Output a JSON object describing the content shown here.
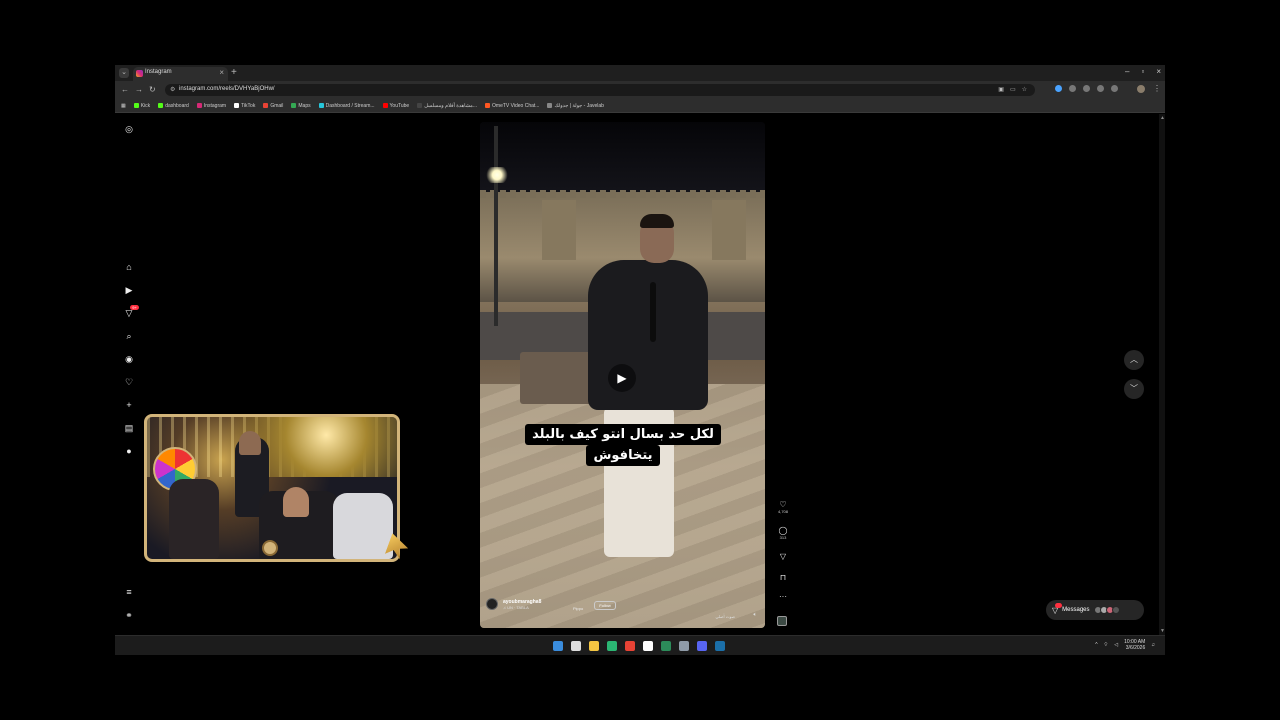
{
  "browser": {
    "tab_title": "Instagram",
    "tab_close": "×",
    "new_tab": "+",
    "url": "instagram.com/reels/DVHYaBjOHw/",
    "window_controls": [
      "–",
      "▫",
      "×"
    ],
    "bookmarks": [
      {
        "label": "Kick",
        "color": "#53fc18"
      },
      {
        "label": "dashboard",
        "color": "#53fc18"
      },
      {
        "label": "Instagram",
        "color": "#d62976"
      },
      {
        "label": "TikTok",
        "color": "#ffffff"
      },
      {
        "label": "Gmail",
        "color": "#ea4335"
      },
      {
        "label": "Maps",
        "color": "#34a853"
      },
      {
        "label": "Dashboard / Stream...",
        "color": "#26c6da"
      },
      {
        "label": "YouTube",
        "color": "#ff0000"
      },
      {
        "label": "مشاهدة أفلام ومسلسل...",
        "color": "#444444"
      },
      {
        "label": "OmeTV Video Chat...",
        "color": "#ff5722"
      },
      {
        "label": "جولة | جدولك - Javelab",
        "color": "#888888"
      }
    ]
  },
  "instagram": {
    "sidebar_icons": [
      "instagram-logo",
      "home",
      "reels",
      "messages",
      "search",
      "explore",
      "notifications",
      "create",
      "dashboard",
      "profile",
      "more",
      "also-from-meta"
    ],
    "notification_badge": "9+",
    "reel": {
      "caption_lines": [
        "لكل حد بسال انتو كيف بالبلد",
        "يتخافوش"
      ],
      "author": "ayoubmaragha8",
      "audio": "♫ UN · TABLA",
      "extra": "Pippo",
      "follow_label": "Follow",
      "audio_tag": "صوت أصلي"
    },
    "actions": [
      {
        "name": "like",
        "glyph": "♡",
        "count": "4,708"
      },
      {
        "name": "comment",
        "glyph": "◯",
        "count": "313"
      },
      {
        "name": "share",
        "glyph": "▽",
        "count": ""
      },
      {
        "name": "save",
        "glyph": "⊓",
        "count": ""
      },
      {
        "name": "more",
        "glyph": "···",
        "count": ""
      }
    ],
    "messages_label": "Messages"
  },
  "taskbar": {
    "time": "10:00 AM",
    "date": "3/6/2026",
    "apps": [
      {
        "name": "start",
        "color": "#3a8dde"
      },
      {
        "name": "search",
        "color": "#dddddd"
      },
      {
        "name": "file-explorer",
        "color": "#f4c542"
      },
      {
        "name": "edge",
        "color": "#2bb673"
      },
      {
        "name": "chrome",
        "color": "#e84335"
      },
      {
        "name": "app-6",
        "color": "#ffffff"
      },
      {
        "name": "terminal",
        "color": "#2c8c5a"
      },
      {
        "name": "app-8",
        "color": "#8f9ba8"
      },
      {
        "name": "discord",
        "color": "#5865f2"
      },
      {
        "name": "steam",
        "color": "#1b6fa8"
      }
    ]
  }
}
